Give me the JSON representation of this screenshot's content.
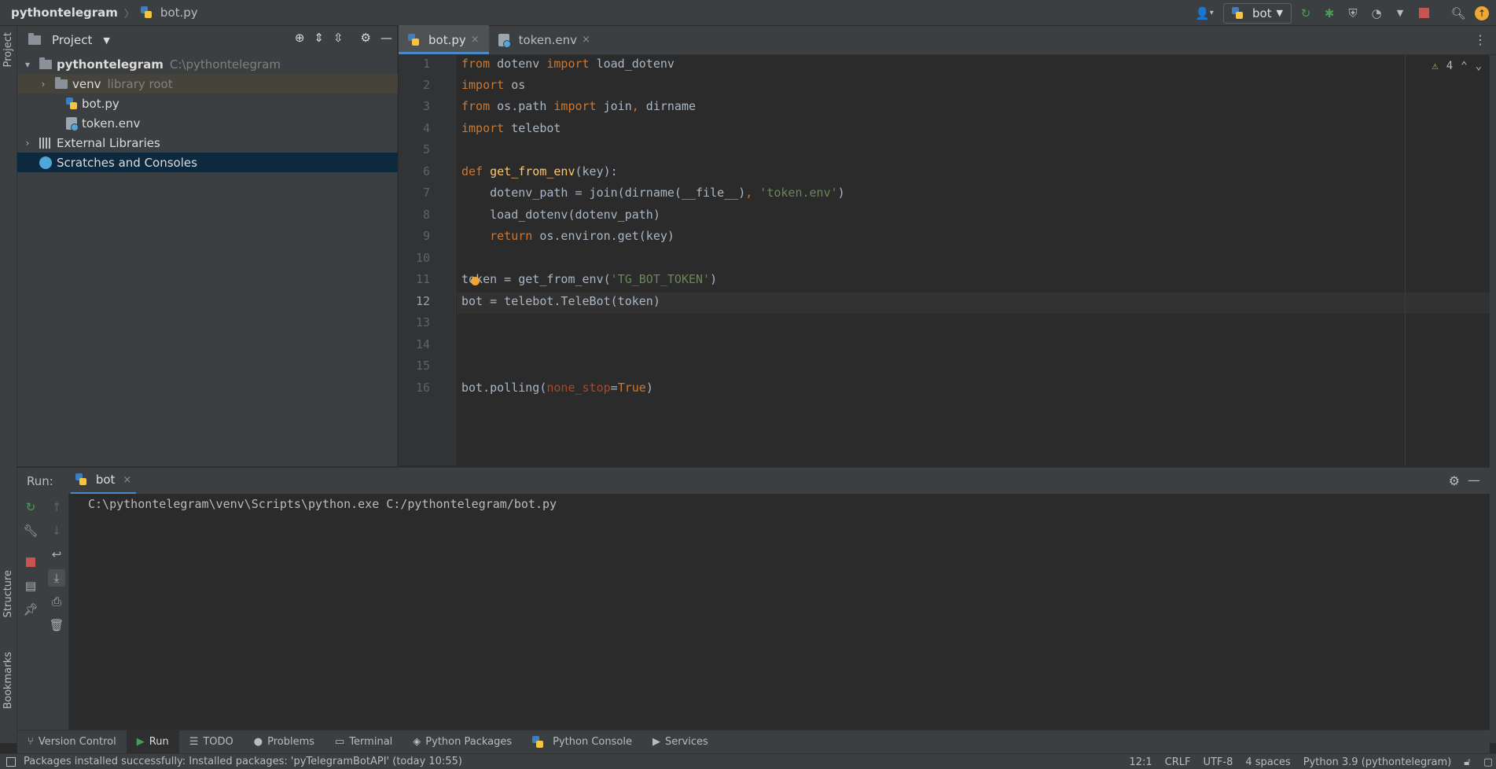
{
  "titlebar": {
    "project": "pythontelegram",
    "file": "bot.py",
    "run_config": "bot"
  },
  "colors": {
    "accent": "#4a88c7",
    "run_green": "#499c54",
    "stop_red": "#c75450",
    "update_orange": "#f0a732"
  },
  "left_stripe": {
    "project": "Project",
    "structure": "Structure",
    "bookmarks": "Bookmarks"
  },
  "project_panel": {
    "title": "Project",
    "tree": [
      {
        "label": "pythontelegram",
        "hint": "C:\\pythontelegram"
      },
      {
        "label": "venv",
        "hint": "library root"
      },
      {
        "label": "bot.py",
        "hint": ""
      },
      {
        "label": "token.env",
        "hint": ""
      },
      {
        "label": "External Libraries",
        "hint": ""
      },
      {
        "label": "Scratches and Consoles",
        "hint": ""
      }
    ]
  },
  "editor": {
    "tabs": [
      {
        "label": "bot.py",
        "close": "×"
      },
      {
        "label": "token.env",
        "close": "×"
      }
    ],
    "warnings": "4",
    "line_numbers": [
      "1",
      "2",
      "3",
      "4",
      "5",
      "6",
      "7",
      "8",
      "9",
      "10",
      "11",
      "12",
      "13",
      "14",
      "15",
      "16"
    ],
    "code": {
      "l1": {
        "a": "from",
        "b": " dotenv ",
        "c": "import",
        "d": " load_dotenv"
      },
      "l2": {
        "a": "import",
        "b": " os"
      },
      "l3": {
        "a": "from",
        "b": " os.path ",
        "c": "import",
        "d": " join",
        "e": ",",
        "f": " dirname"
      },
      "l4": {
        "a": "import",
        "b": " telebot"
      },
      "l6": {
        "a": "def",
        "b": " ",
        "c": "get_from_env",
        "d": "(key):"
      },
      "l7": {
        "a": "    dotenv_path = join(dirname(__file__)",
        "b": ",",
        "c": " ",
        "d": "'token.env'",
        "e": ")"
      },
      "l8": {
        "a": "    load_dotenv(dotenv_path)"
      },
      "l9": {
        "a": "    ",
        "b": "return",
        "c": " os.environ.get(key)"
      },
      "l11": {
        "a": "token = get_from_env(",
        "b": "'TG_BOT_TOKEN'",
        "c": ")"
      },
      "l12": {
        "a": "bot = telebot.TeleBot(token)"
      },
      "l16": {
        "a": "bot.polling(",
        "b": "none_stop",
        "c": "=",
        "d": "True",
        "e": ")"
      }
    }
  },
  "run_panel": {
    "label": "Run:",
    "tab": "bot",
    "tab_close": "×",
    "console_line": "C:\\pythontelegram\\venv\\Scripts\\python.exe C:/pythontelegram/bot.py"
  },
  "tool_tabs": [
    "Version Control",
    "Run",
    "TODO",
    "Problems",
    "Terminal",
    "Python Packages",
    "Python Console",
    "Services"
  ],
  "statusbar": {
    "message": "Packages installed successfully: Installed packages: 'pyTelegramBotAPI' (today 10:55)",
    "position": "12:1",
    "line_sep": "CRLF",
    "encoding": "UTF-8",
    "indent": "4 spaces",
    "interpreter": "Python 3.9 (pythontelegram)"
  }
}
